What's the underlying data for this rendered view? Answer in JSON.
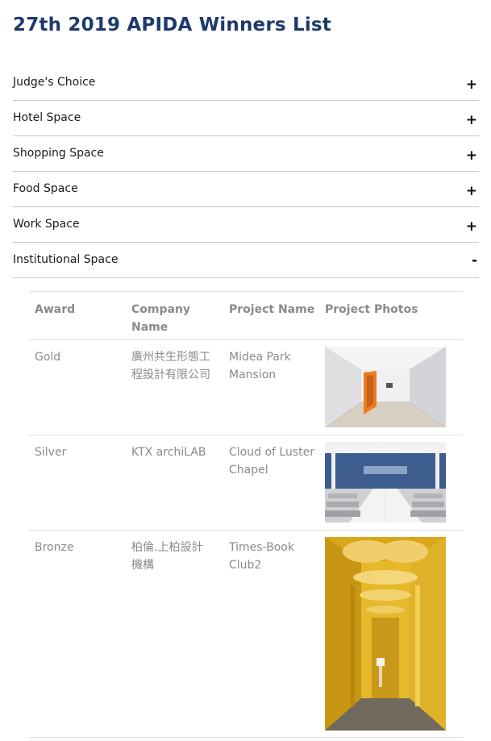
{
  "page": {
    "title": "27th 2019 APIDA Winners List"
  },
  "accordion": {
    "items": [
      {
        "label": "Judge's Choice",
        "icon": "+"
      },
      {
        "label": "Hotel Space",
        "icon": "+"
      },
      {
        "label": "Shopping Space",
        "icon": "+"
      },
      {
        "label": "Food Space",
        "icon": "+"
      },
      {
        "label": "Work Space",
        "icon": "+"
      },
      {
        "label": "Institutional Space",
        "icon": "-"
      }
    ]
  },
  "table": {
    "headers": [
      "Award",
      "Company Name",
      "Project Name",
      "Project Photos"
    ],
    "rows": [
      {
        "award": "Gold",
        "company": "廣州共生形態工程設計有限公司",
        "project": "Midea Park Mansion",
        "photo_icon": "corridor-photo"
      },
      {
        "award": "Silver",
        "company": "KTX archiLAB",
        "project": "Cloud of Luster Chapel",
        "photo_icon": "chapel-photo"
      },
      {
        "award": "Bronze",
        "company": "柏倫.上柏設計機構",
        "project": "Times-Book Club2",
        "photo_icon": "yellow-corridor-photo"
      }
    ]
  },
  "colors": {
    "title": "#1e3a6b",
    "rule": "#c8c8c8",
    "muted_text": "#8a8a8a"
  }
}
